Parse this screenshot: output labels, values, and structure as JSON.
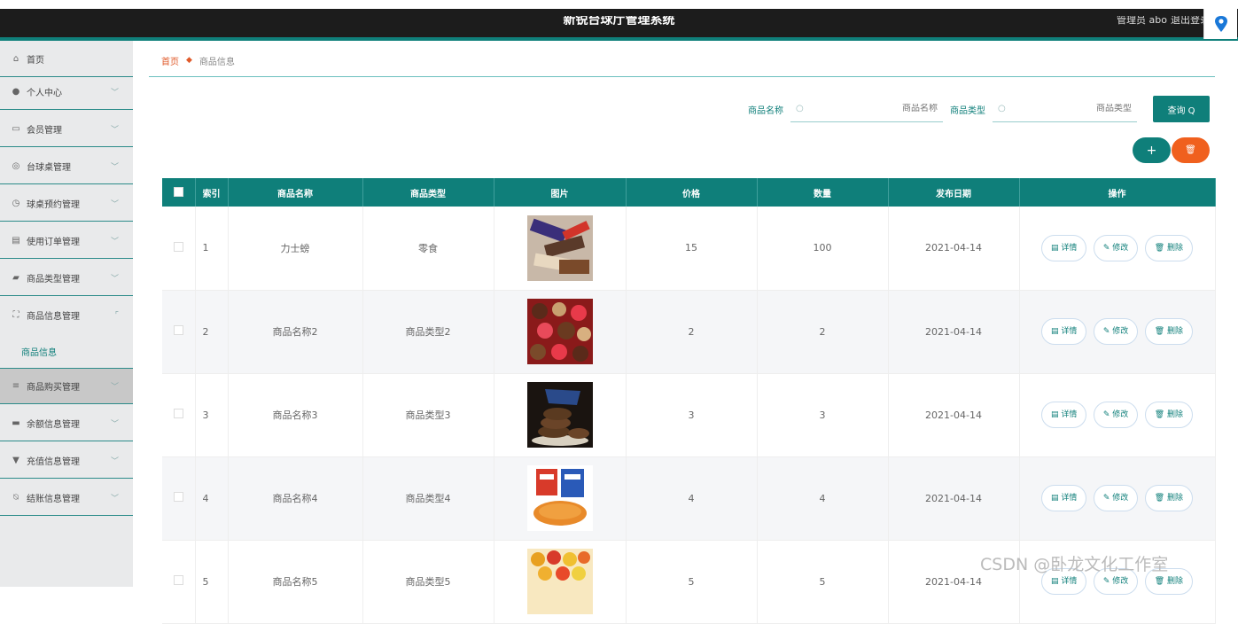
{
  "header": {
    "title": "新锐台球厅管理系统",
    "user": "管理员 abo",
    "logout": "退出登录"
  },
  "sidebar": {
    "items": [
      {
        "label": "首页",
        "icon": "home-icon"
      },
      {
        "label": "个人中心",
        "icon": "user-icon"
      },
      {
        "label": "会员管理",
        "icon": "chat-icon"
      },
      {
        "label": "台球桌管理",
        "icon": "compass-icon"
      },
      {
        "label": "球桌预约管理",
        "icon": "clock-icon"
      },
      {
        "label": "使用订单管理",
        "icon": "doc-icon"
      },
      {
        "label": "商品类型管理",
        "icon": "thumb-icon"
      },
      {
        "label": "商品信息管理",
        "icon": "fullscreen-icon"
      },
      {
        "label": "商品购买管理",
        "icon": "menu-icon"
      },
      {
        "label": "余额信息管理",
        "icon": "message-icon"
      },
      {
        "label": "充值信息管理",
        "icon": "card-icon"
      },
      {
        "label": "结账信息管理",
        "icon": "checkout-icon"
      }
    ],
    "sub_item": "商品信息"
  },
  "breadcrumb": {
    "home": "首页",
    "current": "商品信息"
  },
  "search": {
    "name_label": "商品名称",
    "name_placeholder": "商品名称",
    "type_label": "商品类型",
    "type_placeholder": "商品类型",
    "query_button": "查询 Q"
  },
  "actions": {
    "add": "+",
    "delete": "🗑"
  },
  "table": {
    "columns": [
      "",
      "索引",
      "商品名称",
      "商品类型",
      "图片",
      "价格",
      "数量",
      "发布日期",
      "操作"
    ],
    "rows": [
      {
        "index": "1",
        "name": "力士螃",
        "type": "零食",
        "price": "15",
        "qty": "100",
        "date": "2021-04-14",
        "img": "img-1"
      },
      {
        "index": "2",
        "name": "商品名称2",
        "type": "商品类型2",
        "price": "2",
        "qty": "2",
        "date": "2021-04-14",
        "img": "img-2"
      },
      {
        "index": "3",
        "name": "商品名称3",
        "type": "商品类型3",
        "price": "3",
        "qty": "3",
        "date": "2021-04-14",
        "img": "img-3"
      },
      {
        "index": "4",
        "name": "商品名称4",
        "type": "商品类型4",
        "price": "4",
        "qty": "4",
        "date": "2021-04-14",
        "img": "img-4"
      },
      {
        "index": "5",
        "name": "商品名称5",
        "type": "商品类型5",
        "price": "5",
        "qty": "5",
        "date": "2021-04-14",
        "img": "img-5"
      }
    ],
    "op_detail": "详情",
    "op_edit": "修改",
    "op_delete": "删除"
  },
  "watermark": "CSDN @卧龙文化工作室",
  "colors": {
    "primary": "#0f7f7a",
    "danger": "#f0601e",
    "header_bg": "#1c1c1c"
  }
}
